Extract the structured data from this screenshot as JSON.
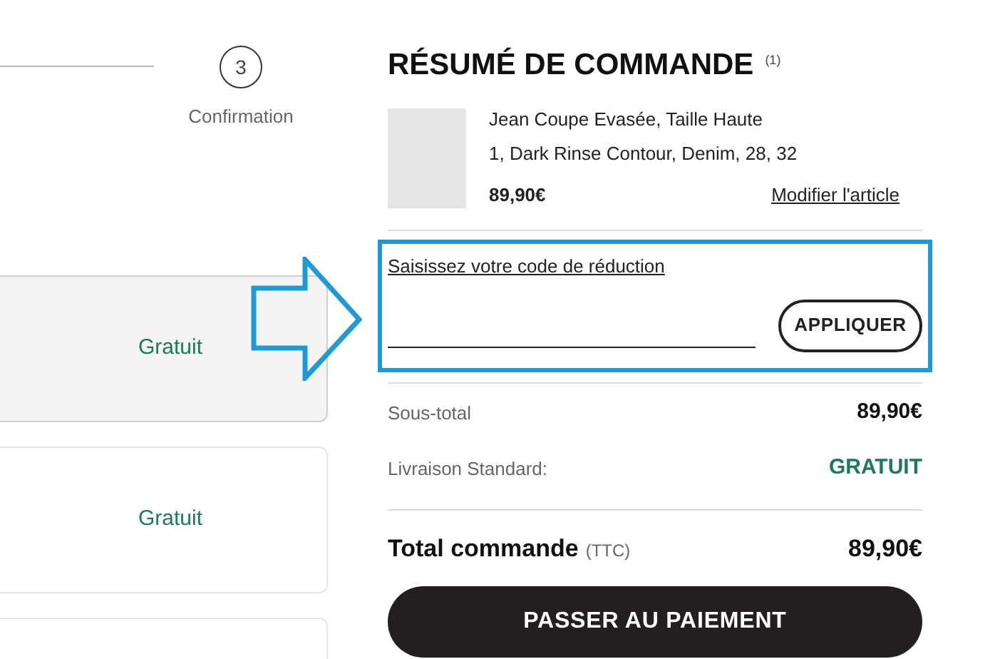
{
  "checkout_steps": {
    "step": {
      "number": "3",
      "label": "Confirmation"
    }
  },
  "shipping_options": [
    {
      "price": "Gratuit",
      "selected": true
    },
    {
      "price": "Gratuit",
      "selected": false
    },
    {
      "selected": false
    }
  ],
  "order_summary": {
    "title": "RÉSUMÉ DE COMMANDE",
    "count": "(1)",
    "items": [
      {
        "name": "Jean Coupe Evasée, Taille Haute",
        "details": "1, Dark Rinse Contour, Denim, 28, 32",
        "price": "89,90€",
        "edit_link": "Modifier l'article"
      }
    ],
    "discount": {
      "label": "Saisissez votre code de réduction",
      "apply_button": "APPLIQUER"
    },
    "lines": [
      {
        "label": "Sous-total",
        "value": "89,90€",
        "kind": "normal"
      },
      {
        "label": "Livraison Standard:",
        "value": "GRATUIT",
        "kind": "free"
      }
    ],
    "total": {
      "label": "Total commande",
      "note": "(TTC)",
      "value": "89,90€"
    },
    "checkout_button": "PASSER AU PAIEMENT"
  }
}
